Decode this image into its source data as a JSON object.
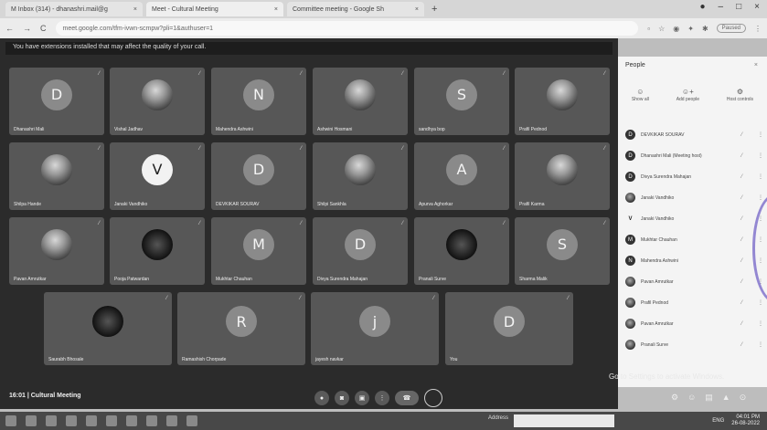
{
  "browser": {
    "tabs": [
      {
        "label": "M Inbox (314) - dhanashri.mail@g",
        "active": false
      },
      {
        "label": "Meet - Cultural Meeting",
        "active": true
      },
      {
        "label": "Committee meeting - Google Sh",
        "active": false
      }
    ],
    "url": "meet.google.com/tfm-ivwn-scmpw?pli=1&authuser=1",
    "paused_label": "Paused"
  },
  "meet": {
    "banner": "You have extensions installed that may affect the quality of your call.",
    "meeting_title": "16:01 | Cultural Meeting",
    "tiles": [
      {
        "name": "Dhanashri Mali",
        "initial": "D",
        "style": "letter"
      },
      {
        "name": "Vishal Jadhav",
        "initial": "",
        "style": "photo"
      },
      {
        "name": "Mahendra Ashwini",
        "initial": "N",
        "style": "letter"
      },
      {
        "name": "Ashwini Hosmani",
        "initial": "",
        "style": "photo"
      },
      {
        "name": "sandhya bop",
        "initial": "S",
        "style": "letter"
      },
      {
        "name": "Prafil Pednod",
        "initial": "",
        "style": "photo"
      },
      {
        "name": "Shilpa Hande",
        "initial": "",
        "style": "photo"
      },
      {
        "name": "Janaki Vandhiko",
        "initial": "V",
        "style": "white"
      },
      {
        "name": "DEVKIKAR SOURAV",
        "initial": "D",
        "style": "letter"
      },
      {
        "name": "Shilpi Sankhla",
        "initial": "",
        "style": "photo"
      },
      {
        "name": "Apurva Aghorkar",
        "initial": "A",
        "style": "letter"
      },
      {
        "name": "Prafil Karma",
        "initial": "",
        "style": "photo"
      },
      {
        "name": "Pavan Amrutkar",
        "initial": "",
        "style": "photo"
      },
      {
        "name": "Pooja Patwardan",
        "initial": "",
        "style": "dark"
      },
      {
        "name": "Mukhtar Chauhan",
        "initial": "M",
        "style": "letter"
      },
      {
        "name": "Divya Surendra Mahajan",
        "initial": "D",
        "style": "letter"
      },
      {
        "name": "Pranali Surve",
        "initial": "",
        "style": "dark"
      },
      {
        "name": "Sharma Malik",
        "initial": "S",
        "style": "letter"
      },
      {
        "name": "Saurabh Bhosale",
        "initial": "",
        "style": "dark"
      },
      {
        "name": "Ramashish Chorpade",
        "initial": "R",
        "style": "letter"
      },
      {
        "name": "jayesh navkar",
        "initial": "j",
        "style": "letter"
      },
      {
        "name": "You",
        "initial": "D",
        "style": "letter"
      }
    ],
    "controls": [
      "mic",
      "camera",
      "present",
      "more",
      "end-call"
    ]
  },
  "people": {
    "title": "People",
    "close": "×",
    "tabs": [
      "Show all",
      "Add people",
      "Host controls"
    ],
    "list": [
      {
        "name": "DEVKIKAR SOURAV",
        "initial": "D",
        "style": "letter"
      },
      {
        "name": "Dhanashri Mali (Meeting host)",
        "initial": "D",
        "style": "letter"
      },
      {
        "name": "Divya Surendra Mahajan",
        "initial": "D",
        "style": "letter"
      },
      {
        "name": "Janaki Vandhiko",
        "initial": "",
        "style": "photo"
      },
      {
        "name": "Janaki Vandhiko",
        "initial": "V",
        "style": "light"
      },
      {
        "name": "Mukhtar Chauhan",
        "initial": "M",
        "style": "letter"
      },
      {
        "name": "Mahendra Ashwini",
        "initial": "N",
        "style": "letter"
      },
      {
        "name": "Pavan Amrutkar",
        "initial": "",
        "style": "photo"
      },
      {
        "name": "Prafil Pednod",
        "initial": "",
        "style": "photo"
      },
      {
        "name": "Pavan Amrutkar",
        "initial": "",
        "style": "photo"
      },
      {
        "name": "Pranali Surve",
        "initial": "",
        "style": "photo"
      }
    ]
  },
  "overlay": {
    "watermark": "Go to Settings to activate Windows."
  },
  "taskbar": {
    "address_label": "Address",
    "lang": "ENG",
    "time": "04:01 PM",
    "date": "26-08-2022"
  }
}
